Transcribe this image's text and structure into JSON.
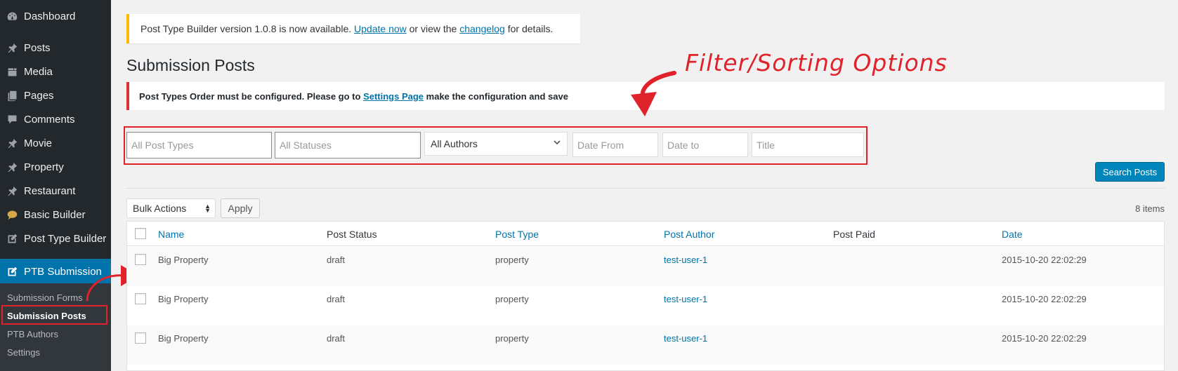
{
  "sidebar": {
    "items": [
      {
        "label": "Dashboard",
        "icon": "dashboard-icon"
      },
      {
        "label": "Posts",
        "icon": "pin-icon"
      },
      {
        "label": "Media",
        "icon": "media-icon"
      },
      {
        "label": "Pages",
        "icon": "pages-icon"
      },
      {
        "label": "Comments",
        "icon": "comment-icon"
      },
      {
        "label": "Movie",
        "icon": "pin-icon"
      },
      {
        "label": "Property",
        "icon": "pin-icon"
      },
      {
        "label": "Restaurant",
        "icon": "pin-icon"
      },
      {
        "label": "Basic Builder",
        "icon": "speech-bubble-icon"
      },
      {
        "label": "Post Type Builder",
        "icon": "edit-icon"
      },
      {
        "label": "PTB Submission",
        "icon": "edit-icon"
      }
    ],
    "submenu": [
      "Submission Forms",
      "Submission Posts",
      "PTB Authors",
      "Settings"
    ]
  },
  "notice_update": {
    "text_before": "Post Type Builder version 1.0.8 is now available.",
    "link1": "Update now",
    "text_mid": "or view the",
    "link2": "changelog",
    "text_after": "for details."
  },
  "page_title": "Submission Posts",
  "notice_error": {
    "text_before": "Post Types Order must be configured. Please go to",
    "link": "Settings Page",
    "text_after": "make the configuration and save"
  },
  "annotation": "Filter/Sorting Options",
  "filters": {
    "post_types_placeholder": "All Post Types",
    "statuses_placeholder": "All Statuses",
    "authors_selected": "All Authors",
    "date_from_placeholder": "Date From",
    "date_to_placeholder": "Date to",
    "title_placeholder": "Title"
  },
  "search_button": "Search Posts",
  "bulk_actions": "Bulk Actions",
  "apply_button": "Apply",
  "items_count": "8 items",
  "table": {
    "columns": [
      "Name",
      "Post Status",
      "Post Type",
      "Post Author",
      "Post Paid",
      "Date"
    ],
    "rows": [
      {
        "name": "Big Property",
        "status": "draft",
        "type": "property",
        "author": "test-user-1",
        "paid": "",
        "date": "2015-10-20 22:02:29"
      },
      {
        "name": "Big Property",
        "status": "draft",
        "type": "property",
        "author": "test-user-1",
        "paid": "",
        "date": "2015-10-20 22:02:29"
      },
      {
        "name": "Big Property",
        "status": "draft",
        "type": "property",
        "author": "test-user-1",
        "paid": "",
        "date": "2015-10-20 22:02:29"
      }
    ]
  },
  "colors": {
    "sidebar_bg": "#23282d",
    "active": "#0073aa",
    "annotation_red": "#e0232b",
    "primary_button": "#0085ba"
  }
}
